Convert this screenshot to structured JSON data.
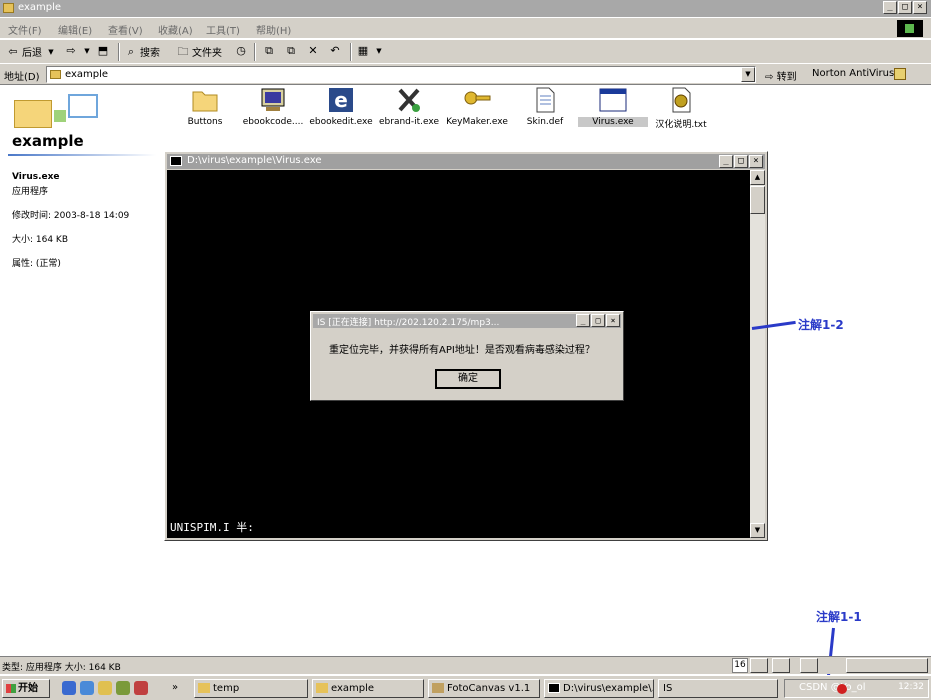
{
  "window": {
    "title": "example",
    "controls": [
      "_",
      "□",
      "×"
    ]
  },
  "menu": [
    "文件(F)",
    "编辑(E)",
    "查看(V)",
    "收藏(A)",
    "工具(T)",
    "帮助(H)"
  ],
  "toolbar": {
    "back": "后退",
    "search": "搜索",
    "folders": "文件夹"
  },
  "address": {
    "label": "地址(D)",
    "value": "example",
    "go": "转到",
    "norton": "Norton AntiVirus"
  },
  "left_pane": {
    "folder_title": "example",
    "file_name": "Virus.exe",
    "file_type": "应用程序",
    "modified": "修改时间: 2003-8-18 14:09",
    "size": "大小: 164 KB",
    "attributes": "属性: (正常)"
  },
  "files": [
    {
      "name": "Buttons",
      "icon": "folder-icon"
    },
    {
      "name": "ebookcode....",
      "icon": "monitor-icon"
    },
    {
      "name": "ebookedit.exe",
      "icon": "e-app-icon"
    },
    {
      "name": "ebrand-it.exe",
      "icon": "tools-icon"
    },
    {
      "name": "KeyMaker.exe",
      "icon": "key-icon"
    },
    {
      "name": "Skin.def",
      "icon": "document-icon"
    },
    {
      "name": "Virus.exe",
      "icon": "window-icon",
      "selected": true
    },
    {
      "name": "汉化说明.txt",
      "icon": "text-file-icon"
    }
  ],
  "console": {
    "title": "D:\\virus\\example\\Virus.exe",
    "prompt": "UNISPIM.I 半:"
  },
  "dialog": {
    "title": "IS      [正在连接] http://202.120.2.175/mp3...",
    "message": "重定位完毕，并获得所有API地址！是否观看病毒感染过程？",
    "ok": "确定"
  },
  "annotations": {
    "a12": "注解1-2",
    "a11": "注解1-1",
    "color": "#2a3ac8"
  },
  "statusbar": {
    "text": "类型: 应用程序 大小: 164 KB",
    "num": "16"
  },
  "taskbar": {
    "start": "开始",
    "tasks": [
      "temp",
      "example",
      "FotoCanvas v1.1",
      "D:\\virus\\example\\...",
      "IS"
    ],
    "tray_text": "CSDN @Yo_ol",
    "clock": "12:32"
  }
}
